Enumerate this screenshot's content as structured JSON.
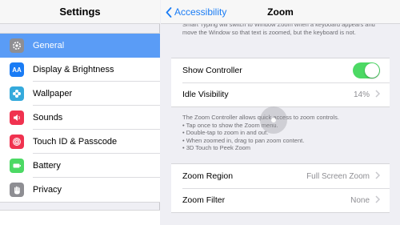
{
  "settings": {
    "title": "Settings",
    "items": [
      {
        "label": "General",
        "icon": "gear-icon",
        "color": "#8e8e93",
        "glyph": "⚙",
        "selected": true
      },
      {
        "label": "Display & Brightness",
        "icon": "text-size-icon",
        "color": "#1a7cf5",
        "glyph": "AA",
        "selected": false
      },
      {
        "label": "Wallpaper",
        "icon": "flower-icon",
        "color": "#35aadc",
        "glyph": "❀",
        "selected": false
      },
      {
        "label": "Sounds",
        "icon": "speaker-icon",
        "color": "#f0324f",
        "glyph": "◀)",
        "selected": false
      },
      {
        "label": "Touch ID & Passcode",
        "icon": "fingerprint-icon",
        "color": "#f0324f",
        "glyph": "◎",
        "selected": false
      },
      {
        "label": "Battery",
        "icon": "battery-icon",
        "color": "#4cd964",
        "glyph": "▭",
        "selected": false
      },
      {
        "label": "Privacy",
        "icon": "hand-icon",
        "color": "#8e8e93",
        "glyph": "✋",
        "selected": false
      }
    ]
  },
  "detail": {
    "back_label": "Accessibility",
    "title": "Zoom",
    "top_note": "Smart Typing will switch to Window Zoom when a keyboard appears and move the Window so that text is zoomed, but the keyboard is not.",
    "show_controller": {
      "label": "Show Controller",
      "enabled": true
    },
    "idle_visibility": {
      "label": "Idle Visibility",
      "value": "14%"
    },
    "controller_note": {
      "intro": "The Zoom Controller allows quick access to zoom controls.",
      "bullets": [
        "• Tap once to show the Zoom menu.",
        "• Double-tap to zoom in and out.",
        "• When zoomed in, drag to pan zoom content.",
        "• 3D Touch to Peek Zoom"
      ]
    },
    "zoom_region": {
      "label": "Zoom Region",
      "value": "Full Screen Zoom"
    },
    "zoom_filter": {
      "label": "Zoom Filter",
      "value": "None"
    }
  },
  "colors": {
    "accent": "#1a7cf5",
    "selected_row": "#5a9cf6",
    "toggle_on": "#4cd964"
  }
}
